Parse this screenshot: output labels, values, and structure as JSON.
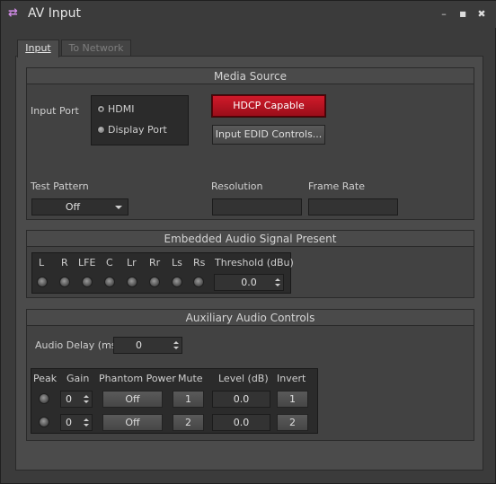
{
  "window": {
    "title": "AV Input",
    "app_icon": "swap-arrows-icon",
    "minimize": "–",
    "maximize": "■",
    "close": "✖"
  },
  "tabs": [
    {
      "label": "Input",
      "active": true
    },
    {
      "label": "To Network",
      "active": false
    }
  ],
  "media_source": {
    "title": "Media Source",
    "input_port_label": "Input Port",
    "ports": [
      {
        "label": "HDMI",
        "selected": true
      },
      {
        "label": "Display Port",
        "selected": false
      }
    ],
    "hdcp_button": "HDCP Capable",
    "edid_button": "Input EDID Controls...",
    "test_pattern_label": "Test Pattern",
    "test_pattern_value": "Off",
    "resolution_label": "Resolution",
    "resolution_value": "",
    "frame_rate_label": "Frame Rate",
    "frame_rate_value": ""
  },
  "embedded_audio": {
    "title": "Embedded Audio Signal Present",
    "channels": [
      "L",
      "R",
      "LFE",
      "C",
      "Lr",
      "Rr",
      "Ls",
      "Rs"
    ],
    "threshold_label": "Threshold (dBu)",
    "threshold_value": "0.0"
  },
  "aux_audio": {
    "title": "Auxiliary Audio Controls",
    "delay_label": "Audio Delay (ms)",
    "delay_value": "0",
    "headers": {
      "peak": "Peak",
      "gain": "Gain",
      "phantom": "Phantom Power",
      "mute": "Mute",
      "level": "Level (dB)",
      "invert": "Invert"
    },
    "rows": [
      {
        "gain": "0",
        "phantom": "Off",
        "mute": "1",
        "level": "0.0",
        "invert": "1"
      },
      {
        "gain": "0",
        "phantom": "Off",
        "mute": "2",
        "level": "0.0",
        "invert": "2"
      }
    ]
  },
  "colors": {
    "accent_red": "#c81424",
    "icon_purple": "#d08be6"
  }
}
